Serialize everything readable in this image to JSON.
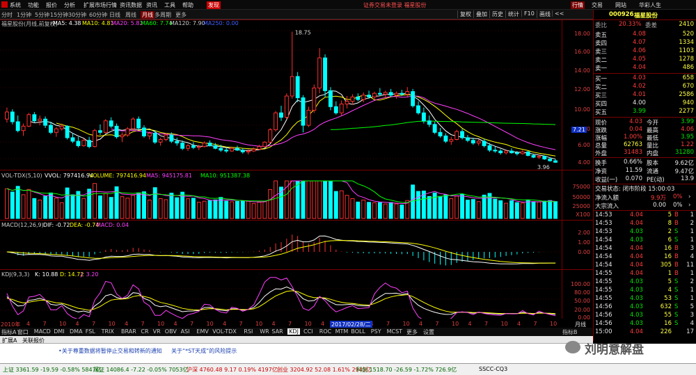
{
  "app": {
    "menu": [
      "系统",
      "功能",
      "报价",
      "分析",
      "扩展市场行情",
      "资讯数据",
      "资讯",
      "工具",
      "帮助"
    ],
    "menu_badge": "发现",
    "title_center": "证券交易未登录  福星股份",
    "title_right": [
      "行情",
      "交易",
      "网站",
      "华彩人生"
    ]
  },
  "toolbar": {
    "periods": [
      "分时",
      "1分钟",
      "5分钟",
      "15分钟",
      "30分钟",
      "60分钟",
      "日线",
      "周线",
      "月线",
      "多周期",
      "更多"
    ],
    "active_period": "月线",
    "right_tabs": [
      "复权",
      "叠加",
      "历史",
      "统计",
      "F10",
      "画线",
      "<<"
    ]
  },
  "main_chart": {
    "title": "福星股份(月线,前复权)",
    "ma": [
      {
        "label": "MA5: 4.38",
        "color": "#ffffff"
      },
      {
        "label": "MA10: 4.81",
        "color": "#ffff00"
      },
      {
        "label": "MA20: 5.82",
        "color": "#ff40ff"
      },
      {
        "label": "MA60: 7.74",
        "color": "#00ff00"
      },
      {
        "label": "MA120: 7.90",
        "color": "#cccccc"
      },
      {
        "label": "MA250: 0.00",
        "color": "#4060ff"
      }
    ],
    "y_ticks": [
      "18.00",
      "16.00",
      "14.00",
      "12.00",
      "10.00",
      "8.00",
      "6.00",
      "4.00"
    ],
    "high_label": "18.75",
    "low_label": "3.96",
    "current_price_tag": "7.21"
  },
  "volume_panel": {
    "labels": [
      {
        "text": "VOL-TDX(5,10)",
        "color": "#cccccc"
      },
      {
        "text": "VVOL: 797416.94",
        "color": "#ffffff"
      },
      {
        "text": "VOLUME: 797416.94",
        "color": "#ffff00"
      },
      {
        "text": "MA5: 945175.81",
        "color": "#ff40ff"
      },
      {
        "text": "MA10: 951387.38",
        "color": "#00ff00"
      }
    ],
    "y_ticks": [
      "75000",
      "50000",
      "25000",
      "X100"
    ]
  },
  "macd_panel": {
    "labels": [
      {
        "text": "MACD(12,26,9)",
        "color": "#cccccc"
      },
      {
        "text": "DIF: -0.72",
        "color": "#ffffff"
      },
      {
        "text": "DEA: -0.74",
        "color": "#ffff00"
      },
      {
        "text": "MACD: 0.04",
        "color": "#ff40ff"
      }
    ],
    "y_ticks": [
      "2.00",
      "1.00",
      "0.00"
    ]
  },
  "kdj_panel": {
    "labels": [
      {
        "text": "KDJ(9,3,3)",
        "color": "#cccccc"
      },
      {
        "text": "K: 10.88",
        "color": "#ffffff"
      },
      {
        "text": "D: 14.72",
        "color": "#ffff00"
      },
      {
        "text": "J: 3.20",
        "color": "#ff40ff"
      }
    ],
    "y_ticks": [
      "100.00",
      "80.00",
      "50.00",
      "20.00",
      "0.00"
    ]
  },
  "time_axis": {
    "start": "2010年",
    "ticks": [
      "4",
      "7",
      "10",
      "4",
      "7",
      "10",
      "4",
      "7",
      "10",
      "4",
      "7",
      "10",
      "4",
      "7",
      "10",
      "4",
      "7",
      "10",
      "4",
      "7",
      "10",
      "4",
      "7",
      "10",
      "4",
      "7",
      "10",
      "4",
      "7",
      "10",
      "4",
      "7",
      "10"
    ],
    "cursor_label": "2017/02/28/二",
    "right_label": "月线"
  },
  "indicator_tabs": {
    "items": [
      "指标A",
      "窗口",
      "MACD",
      "DMI",
      "DMA",
      "FSL",
      "TRIX",
      "BRAR",
      "CR",
      "VR",
      "OBV",
      "ASI",
      "EMV",
      "VOL-TDX",
      "RSI",
      "WR",
      "SAR",
      "KDJ",
      "CCI",
      "ROC",
      "MTM",
      "BOLL",
      "PSY",
      "MCST",
      "更多",
      "设置"
    ],
    "active": "KDJ",
    "right": "指标B"
  },
  "bottom_tabs": [
    "扩展A",
    "关联报价"
  ],
  "news": [
    "•关于尊重数据将暂停止交易和转新的通知",
    "关于“*ST天成”的风险提示"
  ],
  "watermark": "刘明意解盘",
  "quote_panel": {
    "code": "000926",
    "name": "福星股份",
    "weibi": "委比",
    "weibi_val": "20.33%",
    "weicha": "委差",
    "weicha_val": "2410",
    "asks": [
      {
        "label": "卖五",
        "price": "4.08",
        "vol": "520"
      },
      {
        "label": "卖四",
        "price": "4.07",
        "vol": "1334"
      },
      {
        "label": "卖三",
        "price": "4.06",
        "vol": "1103"
      },
      {
        "label": "卖二",
        "price": "4.05",
        "vol": "1278"
      },
      {
        "label": "卖一",
        "price": "4.04",
        "vol": "486"
      }
    ],
    "bids": [
      {
        "label": "买一",
        "price": "4.03",
        "vol": "658"
      },
      {
        "label": "买二",
        "price": "4.02",
        "vol": "670"
      },
      {
        "label": "买三",
        "price": "4.01",
        "vol": "2586"
      },
      {
        "label": "买四",
        "price": "4.00",
        "vol": "940"
      },
      {
        "label": "买五",
        "price": "3.99",
        "vol": "2277"
      }
    ],
    "stats": [
      {
        "l1": "现价",
        "v1": "4.03",
        "c1": "red",
        "l2": "今开",
        "v2": "3.99",
        "c2": "grn"
      },
      {
        "l1": "涨跌",
        "v1": "0.04",
        "c1": "red",
        "l2": "最高",
        "v2": "4.06",
        "c2": "red"
      },
      {
        "l1": "涨幅",
        "v1": "1.00%",
        "c1": "red",
        "l2": "最低",
        "v2": "3.95",
        "c2": "grn"
      },
      {
        "l1": "总量",
        "v1": "62763",
        "c1": "yel",
        "l2": "量比",
        "v2": "1.22",
        "c2": "red"
      },
      {
        "l1": "外盘",
        "v1": "31483",
        "c1": "red",
        "l2": "内盘",
        "v2": "31280",
        "c2": "grn"
      }
    ],
    "stats2": [
      {
        "l1": "换手",
        "v1": "0.66%",
        "l2": "股本",
        "v2": "9.62亿"
      },
      {
        "l1": "净资",
        "v1": "11.59",
        "l2": "流通",
        "v2": "9.47亿"
      },
      {
        "l1": "收益(一)",
        "v1": "0.070",
        "l2": "PE(动)",
        "v2": "13.9"
      }
    ],
    "status": "交易状态: 闭市阶段 15:00:03",
    "flow": [
      {
        "label": "净流入额",
        "val": "9.9万",
        "pct": "0%",
        "c": "red"
      },
      {
        "label": "大宗流入",
        "val": "0.00",
        "pct": "0%",
        "c": "wht"
      }
    ],
    "ticks": [
      {
        "t": "14:53",
        "p": "4.04",
        "v": "5",
        "s": "B",
        "n": "1",
        "c": "red"
      },
      {
        "t": "14:53",
        "p": "4.04",
        "v": "8",
        "s": "B",
        "n": "2",
        "c": "red"
      },
      {
        "t": "14:53",
        "p": "4.03",
        "v": "2",
        "s": "S",
        "n": "1",
        "c": "grn"
      },
      {
        "t": "14:54",
        "p": "4.03",
        "v": "6",
        "s": "S",
        "n": "1",
        "c": "grn"
      },
      {
        "t": "14:54",
        "p": "4.04",
        "v": "16",
        "s": "B",
        "n": "3",
        "c": "red"
      },
      {
        "t": "14:54",
        "p": "4.04",
        "v": "16",
        "s": "B",
        "n": "4",
        "c": "red"
      },
      {
        "t": "14:54",
        "p": "4.04",
        "v": "305",
        "s": "B",
        "n": "11",
        "c": "red"
      },
      {
        "t": "14:55",
        "p": "4.04",
        "v": "1",
        "s": "B",
        "n": "1",
        "c": "red"
      },
      {
        "t": "14:55",
        "p": "4.03",
        "v": "5",
        "s": "S",
        "n": "2",
        "c": "grn"
      },
      {
        "t": "14:55",
        "p": "4.03",
        "v": "4",
        "s": "S",
        "n": "1",
        "c": "grn"
      },
      {
        "t": "14:55",
        "p": "4.03",
        "v": "53",
        "s": "S",
        "n": "1",
        "c": "grn"
      },
      {
        "t": "14:56",
        "p": "4.03",
        "v": "632",
        "s": "S",
        "n": "5",
        "c": "grn"
      },
      {
        "t": "14:56",
        "p": "4.03",
        "v": "55",
        "s": "S",
        "n": "3",
        "c": "grn"
      },
      {
        "t": "14:56",
        "p": "4.03",
        "v": "16",
        "s": "S",
        "n": "4",
        "c": "grn"
      },
      {
        "t": "15:00",
        "p": "4.04",
        "v": "226",
        "s": "",
        "n": "17",
        "c": "red"
      }
    ]
  },
  "status_bar": [
    {
      "text": "上证 3361.59 -19.59 -0.58% 5847亿",
      "color": "#006600"
    },
    {
      "text": "深证 14086.4 -7.22 -0.05% 7053亿",
      "color": "#006600"
    },
    {
      "text": "沪深 4760.48 9.17 0.19% 4197亿",
      "color": "#cc0000"
    },
    {
      "text": "创业 3204.92 52.08 1.61% 2945亿",
      "color": "#cc0000"
    },
    {
      "text": "科创 1518.70 -26.59 -1.72% 726.9亿",
      "color": "#006600"
    },
    {
      "text": "SSCC-CQ3",
      "color": "#000000"
    }
  ],
  "chart_data": {
    "type": "candlestick",
    "title": "福星股份(月线,前复权)",
    "ylim": [
      3.5,
      19.5
    ],
    "ohlc": [
      [
        8.9,
        10.2,
        8.5,
        9.7
      ],
      [
        9.7,
        10.0,
        8.3,
        8.6
      ],
      [
        8.6,
        9.3,
        7.4,
        7.6
      ],
      [
        7.6,
        8.4,
        7.0,
        8.1
      ],
      [
        8.1,
        9.6,
        8.0,
        9.4
      ],
      [
        9.4,
        9.7,
        8.5,
        8.7
      ],
      [
        8.7,
        9.3,
        8.2,
        8.9
      ],
      [
        8.9,
        9.2,
        7.9,
        8.2
      ],
      [
        8.2,
        8.6,
        7.2,
        7.4
      ],
      [
        7.4,
        8.0,
        6.9,
        7.8
      ],
      [
        7.8,
        8.4,
        7.6,
        8.1
      ],
      [
        8.1,
        8.2,
        6.6,
        6.8
      ],
      [
        6.8,
        7.3,
        6.2,
        6.4
      ],
      [
        6.4,
        6.9,
        5.7,
        5.9
      ],
      [
        5.9,
        6.7,
        5.8,
        6.5
      ],
      [
        6.5,
        6.9,
        5.6,
        5.8
      ],
      [
        5.8,
        7.8,
        5.7,
        7.6
      ],
      [
        7.6,
        8.3,
        7.1,
        7.4
      ],
      [
        7.4,
        8.9,
        7.3,
        8.7
      ],
      [
        8.7,
        9.1,
        7.9,
        8.1
      ],
      [
        8.1,
        8.4,
        6.7,
        6.9
      ],
      [
        6.9,
        7.4,
        6.3,
        7.1
      ],
      [
        7.1,
        8.0,
        6.9,
        7.8
      ],
      [
        7.8,
        9.1,
        7.6,
        8.9
      ],
      [
        8.9,
        9.2,
        7.7,
        7.9
      ],
      [
        7.9,
        8.2,
        6.8,
        7.0
      ],
      [
        7.0,
        7.5,
        6.6,
        7.3
      ],
      [
        7.3,
        7.6,
        6.1,
        6.3
      ],
      [
        6.3,
        6.8,
        5.9,
        6.6
      ],
      [
        6.6,
        7.3,
        6.4,
        7.1
      ],
      [
        7.1,
        7.4,
        6.2,
        6.4
      ],
      [
        6.4,
        6.8,
        5.9,
        6.2
      ],
      [
        6.2,
        6.5,
        5.4,
        5.6
      ],
      [
        5.6,
        6.1,
        5.3,
        5.9
      ],
      [
        5.9,
        6.3,
        5.5,
        5.7
      ],
      [
        5.7,
        6.0,
        5.4,
        5.8
      ],
      [
        5.8,
        6.4,
        5.7,
        6.2
      ],
      [
        6.2,
        6.5,
        5.8,
        5.9
      ],
      [
        5.9,
        6.2,
        5.5,
        5.6
      ],
      [
        5.6,
        6.0,
        5.2,
        5.4
      ],
      [
        5.4,
        5.7,
        5.1,
        5.3
      ],
      [
        5.3,
        5.8,
        5.2,
        5.6
      ],
      [
        5.6,
        5.9,
        5.3,
        5.4
      ],
      [
        5.4,
        5.6,
        5.0,
        5.2
      ],
      [
        5.2,
        5.5,
        4.9,
        5.3
      ],
      [
        5.3,
        5.7,
        5.2,
        5.5
      ],
      [
        5.5,
        6.0,
        5.4,
        5.8
      ],
      [
        5.8,
        6.4,
        5.7,
        6.3
      ],
      [
        6.3,
        7.9,
        6.2,
        7.7
      ],
      [
        7.7,
        9.8,
        7.5,
        9.6
      ],
      [
        9.6,
        10.4,
        8.7,
        9.1
      ],
      [
        9.1,
        11.8,
        8.9,
        11.5
      ],
      [
        11.5,
        18.75,
        11.2,
        13.7
      ],
      [
        13.7,
        14.2,
        10.8,
        11.3
      ],
      [
        11.3,
        11.6,
        7.4,
        8.2
      ],
      [
        8.2,
        10.3,
        8.0,
        9.9
      ],
      [
        9.9,
        12.8,
        9.6,
        12.4
      ],
      [
        12.4,
        16.9,
        11.8,
        15.8
      ],
      [
        15.8,
        16.2,
        11.4,
        12.1
      ],
      [
        12.1,
        12.5,
        9.9,
        10.3
      ],
      [
        10.3,
        10.9,
        9.4,
        9.6
      ],
      [
        9.6,
        11.0,
        9.3,
        10.6
      ],
      [
        10.6,
        11.5,
        10.1,
        10.9
      ],
      [
        10.9,
        11.7,
        10.5,
        11.4
      ],
      [
        11.4,
        11.8,
        10.9,
        11.1
      ],
      [
        11.1,
        11.9,
        10.8,
        11.6
      ],
      [
        11.6,
        12.1,
        11.2,
        11.4
      ],
      [
        11.4,
        12.0,
        11.1,
        11.8
      ],
      [
        11.8,
        12.4,
        11.5,
        11.7
      ],
      [
        11.7,
        12.1,
        11.3,
        11.9
      ],
      [
        11.9,
        12.3,
        11.4,
        11.6
      ],
      [
        11.6,
        12.0,
        11.2,
        11.8
      ],
      [
        11.8,
        12.2,
        11.5,
        11.7
      ],
      [
        11.7,
        12.5,
        11.4,
        12.0
      ],
      [
        12.0,
        12.3,
        10.2,
        10.4
      ],
      [
        10.4,
        10.9,
        9.4,
        9.6
      ],
      [
        9.6,
        10.2,
        8.4,
        8.7
      ],
      [
        8.7,
        9.3,
        8.0,
        8.3
      ],
      [
        8.3,
        8.6,
        7.2,
        7.4
      ],
      [
        7.4,
        7.9,
        6.8,
        7.0
      ],
      [
        7.0,
        7.3,
        6.2,
        6.4
      ],
      [
        6.4,
        6.9,
        6.0,
        6.6
      ],
      [
        6.6,
        7.7,
        6.5,
        7.5
      ],
      [
        7.5,
        7.8,
        6.6,
        6.8
      ],
      [
        6.8,
        7.1,
        6.3,
        6.5
      ],
      [
        6.5,
        6.8,
        6.0,
        6.2
      ],
      [
        6.2,
        6.6,
        5.9,
        6.4
      ],
      [
        6.4,
        6.7,
        5.7,
        5.9
      ],
      [
        5.9,
        6.2,
        5.2,
        5.4
      ],
      [
        5.4,
        5.8,
        5.1,
        5.3
      ],
      [
        5.3,
        5.5,
        4.9,
        5.1
      ],
      [
        5.1,
        5.4,
        4.9,
        5.3
      ],
      [
        5.3,
        5.6,
        5.0,
        5.1
      ],
      [
        5.1,
        5.3,
        4.8,
        5.0
      ],
      [
        5.0,
        5.4,
        4.9,
        5.2
      ],
      [
        5.2,
        5.3,
        4.7,
        4.8
      ],
      [
        4.8,
        5.0,
        4.5,
        4.6
      ],
      [
        4.6,
        4.9,
        4.4,
        4.7
      ],
      [
        4.7,
        4.8,
        4.3,
        4.4
      ],
      [
        4.4,
        4.6,
        4.1,
        4.2
      ],
      [
        4.2,
        4.4,
        3.96,
        4.03
      ]
    ],
    "ma_lines": [
      {
        "name": "MA5",
        "color": "#ffffff"
      },
      {
        "name": "MA10",
        "color": "#ffff00"
      },
      {
        "name": "MA20",
        "color": "#ff40ff"
      },
      {
        "name": "MA60",
        "color": "#00ff00"
      }
    ]
  }
}
